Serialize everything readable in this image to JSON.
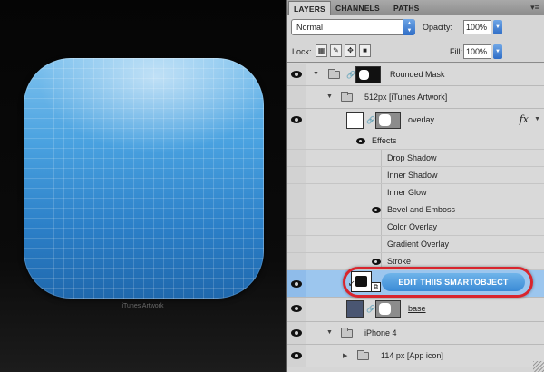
{
  "canvas": {
    "icon_caption": "iTunes Artwork"
  },
  "panel": {
    "tabs": [
      {
        "label": "LAYERS",
        "active": true
      },
      {
        "label": "CHANNELS",
        "active": false
      },
      {
        "label": "PATHS",
        "active": false
      }
    ],
    "menu_icon": "panel-menu-icon",
    "blend_mode": "Normal",
    "opacity_label": "Opacity:",
    "opacity_value": "100%",
    "lock_label": "Lock:",
    "fill_label": "Fill:",
    "fill_value": "100%"
  },
  "layers": {
    "rounded_mask": "Rounded Mask",
    "group_512": "512px [iTunes Artwork]",
    "overlay": "overlay",
    "fx_symbol": "fx",
    "effects_label": "Effects",
    "effects": [
      {
        "name": "Drop Shadow",
        "visible": false
      },
      {
        "name": "Inner Shadow",
        "visible": false
      },
      {
        "name": "Inner Glow",
        "visible": false
      },
      {
        "name": "Bevel and Emboss",
        "visible": true
      },
      {
        "name": "Color Overlay",
        "visible": false
      },
      {
        "name": "Gradient Overlay",
        "visible": false
      },
      {
        "name": "Stroke",
        "visible": true
      }
    ],
    "smart_object_label": "EDIT THIIS SMARTOBJECT",
    "base": "base",
    "iphone_group": "iPhone 4",
    "app_icon_group": "114 px [App icon]"
  },
  "colors": {
    "highlight_border": "#d8252d",
    "selection": "#9cc6ee",
    "icon_blue": "#2c80c8"
  }
}
